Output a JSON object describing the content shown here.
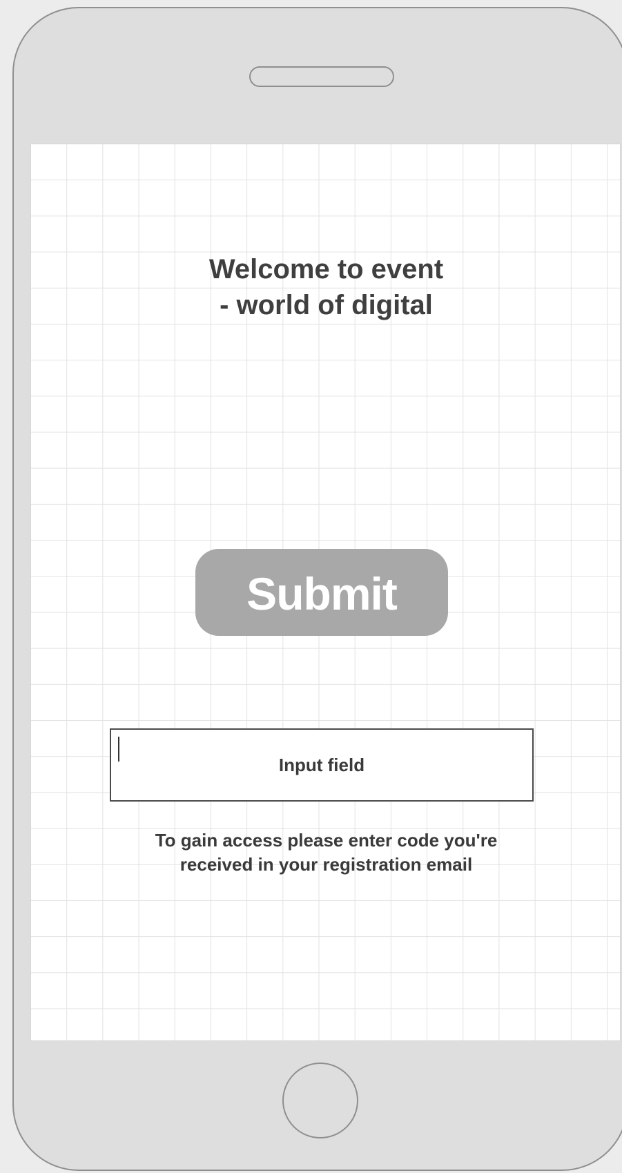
{
  "screen": {
    "title_lines": [
      "Welcome to event",
      "- world of digital"
    ],
    "submit_label": "Submit",
    "input": {
      "placeholder": "Input field"
    },
    "help_lines": [
      "To gain access please enter code you're",
      "received in your registration email"
    ]
  },
  "colors": {
    "device_body": "#dedede",
    "device_outline": "#8f8f8f",
    "screen_background": "#ffffff",
    "grid_line": "#e2e2e2",
    "button_fill": "#a8a8a8",
    "button_text": "#ffffff",
    "text": "#3f3f3f"
  }
}
